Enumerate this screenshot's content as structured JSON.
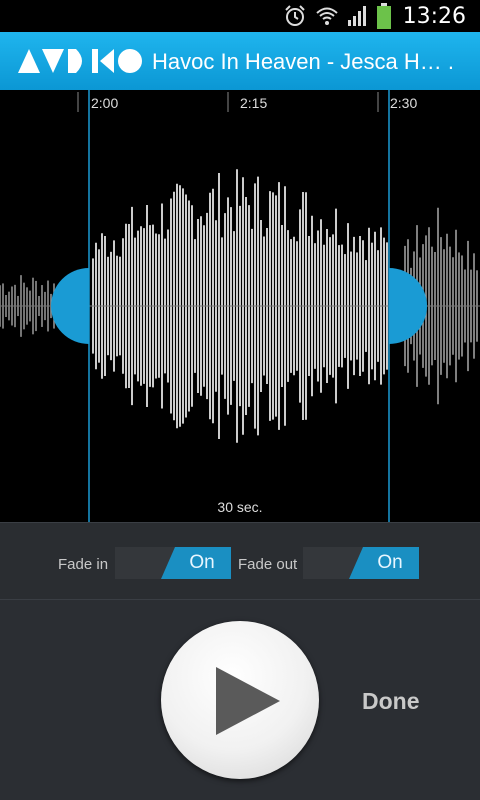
{
  "status_bar": {
    "time": "13:26",
    "icons": [
      "alarm-icon",
      "wifi-icon",
      "signal-icon",
      "battery-icon"
    ],
    "battery_color": "#6cc24a"
  },
  "header": {
    "logo_text": "AVDIKO",
    "title": "Havoc In Heaven - Jesca H… ."
  },
  "timeline": {
    "ticks": [
      "2:00",
      "2:15",
      "2:30"
    ]
  },
  "selection": {
    "duration_label": "30 sec.",
    "accent_color": "#1a9bd4"
  },
  "fade": {
    "fade_in_label": "Fade in",
    "fade_in_state": "On",
    "fade_out_label": "Fade out",
    "fade_out_state": "On"
  },
  "controls": {
    "play_icon": "play-icon",
    "done_label": "Done"
  }
}
